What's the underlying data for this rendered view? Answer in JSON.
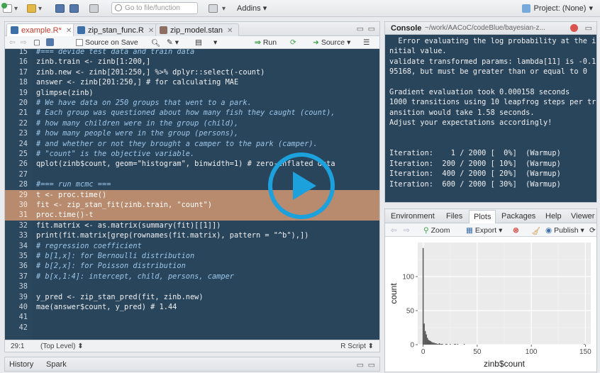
{
  "toolbar": {
    "goto_placeholder": "Go to file/function",
    "addins_label": "Addins",
    "project_label": "Project: (None)"
  },
  "editor": {
    "tabs": [
      {
        "label": "example.R*",
        "active": true
      },
      {
        "label": "zip_stan_func.R",
        "active": false
      },
      {
        "label": "zip_model.stan",
        "active": false
      }
    ],
    "toolbar": {
      "source_on_save": "Source on Save",
      "run": "Run",
      "source": "Source"
    },
    "lines": [
      {
        "n": "15",
        "text": "#=== devide test data and train data",
        "comment": true
      },
      {
        "n": "16",
        "text": "zinb.train <- zinb[1:200,]"
      },
      {
        "n": "17",
        "text": "zinb.new <- zinb[201:250,] %>% dplyr::select(-count)"
      },
      {
        "n": "18",
        "text": "answer <- zinb[201:250,] # for calculating MAE"
      },
      {
        "n": "19",
        "text": "glimpse(zinb)"
      },
      {
        "n": "20",
        "text": "# We have data on 250 groups that went to a park.",
        "comment": true
      },
      {
        "n": "21",
        "text": "# Each group was questioned about how many fish they caught (count),",
        "comment": true
      },
      {
        "n": "22",
        "text": "# how many children were in the group (child),",
        "comment": true
      },
      {
        "n": "23",
        "text": "# how many people were in the group (persons),",
        "comment": true
      },
      {
        "n": "24",
        "text": "# and whether or not they brought a camper to the park (camper).",
        "comment": true
      },
      {
        "n": "25",
        "text": "# \"count\" is the objective variable.",
        "comment": true
      },
      {
        "n": "26",
        "text": "qplot(zinb$count, geom=\"histogram\", binwidth=1) # zero-inflated data"
      },
      {
        "n": "27",
        "text": ""
      },
      {
        "n": "28",
        "text": "#=== run mcmc ===",
        "comment": true
      },
      {
        "n": "29",
        "text": "t <- proc.time()",
        "hl": true
      },
      {
        "n": "30",
        "text": "fit <- zip_stan_fit(zinb.train, \"count\")",
        "hl": true
      },
      {
        "n": "31",
        "text": "proc.time()-t",
        "hl": true
      },
      {
        "n": "32",
        "text": "fit.matrix <- as.matrix(summary(fit)[[1]])"
      },
      {
        "n": "33",
        "text": "print(fit.matrix[grep(rownames(fit.matrix), pattern = \"^b\"),])"
      },
      {
        "n": "34",
        "text": "# regression coefficient",
        "comment": true
      },
      {
        "n": "35",
        "text": "# b[1,x]: for Bernoulli distribution",
        "comment": true
      },
      {
        "n": "36",
        "text": "# b[2,x]: for Poisson distribution",
        "comment": true
      },
      {
        "n": "37",
        "text": "# b[x,1:4]: intercept, child, persons, camper",
        "comment": true
      },
      {
        "n": "38",
        "text": ""
      },
      {
        "n": "39",
        "text": "y_pred <- zip_stan_pred(fit, zinb.new)"
      },
      {
        "n": "40",
        "text": "mae(answer$count, y_pred) # 1.44"
      },
      {
        "n": "41",
        "text": ""
      },
      {
        "n": "42",
        "text": ""
      }
    ],
    "status": {
      "position": "29:1",
      "scope": "(Top Level) ⬍",
      "filetype": "R Script ⬍"
    }
  },
  "bottom_tabs": {
    "history": "History",
    "spark": "Spark"
  },
  "console": {
    "title": "Console",
    "path": "~/work/AACoC/codeBlue/bayesian-z...",
    "lines": [
      "  Error evaluating the log probability at the i",
      "nitial value.",
      "validate transformed params: lambda[11] is -0.1",
      "95168, but must be greater than or equal to 0",
      "",
      "Gradient evaluation took 0.000158 seconds",
      "1000 transitions using 10 leapfrog steps per tr",
      "ansition would take 1.58 seconds.",
      "Adjust your expectations accordingly!",
      "",
      "",
      "Iteration:    1 / 2000 [  0%]  (Warmup)",
      "Iteration:  200 / 2000 [ 10%]  (Warmup)",
      "Iteration:  400 / 2000 [ 20%]  (Warmup)",
      "Iteration:  600 / 2000 [ 30%]  (Warmup)"
    ]
  },
  "plots_pane": {
    "tabs": [
      "Environment",
      "Files",
      "Plots",
      "Packages",
      "Help",
      "Viewer"
    ],
    "active_tab": "Plots",
    "toolbar": {
      "zoom": "Zoom",
      "export": "Export ▾",
      "publish": "Publish ▾"
    }
  },
  "chart_data": {
    "type": "bar",
    "x": [
      0,
      1,
      2,
      3,
      4,
      5,
      6,
      7,
      8,
      9,
      10,
      11,
      12,
      13,
      14,
      15,
      16,
      17,
      18,
      21,
      22,
      25,
      29,
      30,
      32,
      38,
      149
    ],
    "values": [
      142,
      31,
      20,
      15,
      10,
      7,
      6,
      5,
      4,
      3,
      3,
      2,
      2,
      1,
      1,
      2,
      1,
      1,
      1,
      1,
      1,
      1,
      1,
      1,
      1,
      1,
      1
    ],
    "xlabel": "zinb$count",
    "ylabel": "count",
    "xlim": [
      -5,
      155
    ],
    "ylim": [
      0,
      150
    ],
    "xticks": [
      0,
      50,
      100,
      150
    ],
    "yticks": [
      0,
      50,
      100
    ],
    "grid": true,
    "bar_color": "#595959",
    "panel_bg": "#ebebeb"
  },
  "colors": {
    "editor_bg": "#29455c",
    "selection": "#b88a6e",
    "comment": "#9ec6e8",
    "play_overlay": "#1da1dc"
  }
}
